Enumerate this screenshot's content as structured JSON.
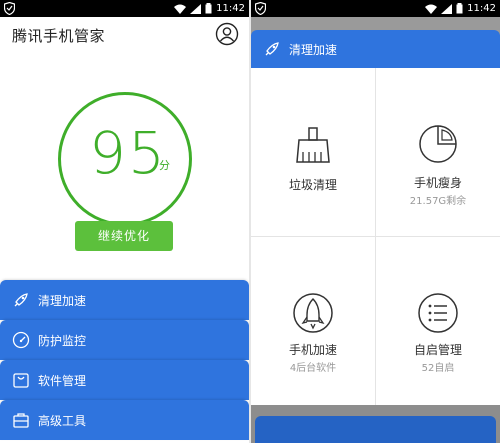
{
  "status_bar": {
    "time": "11:42"
  },
  "left": {
    "app_title": "腾讯手机管家",
    "score": {
      "value": "95",
      "unit": "分"
    },
    "optimize_button": "继续优化",
    "menu": [
      {
        "label": "清理加速",
        "icon": "rocket-icon"
      },
      {
        "label": "防护监控",
        "icon": "gauge-icon"
      },
      {
        "label": "软件管理",
        "icon": "bag-icon"
      },
      {
        "label": "高级工具",
        "icon": "toolbox-icon"
      }
    ]
  },
  "right": {
    "panel_title": "清理加速",
    "cells": [
      {
        "title": "垃圾清理",
        "subtitle": "",
        "icon": "broom-icon"
      },
      {
        "title": "手机瘦身",
        "subtitle": "21.57G剩余",
        "icon": "pie-chart-icon"
      },
      {
        "title": "手机加速",
        "subtitle": "4后台软件",
        "icon": "rocket-circle-icon"
      },
      {
        "title": "自启管理",
        "subtitle": "52自启",
        "icon": "list-icon"
      }
    ]
  },
  "colors": {
    "green": "#3fae2a",
    "button_green": "#5cc03c",
    "blue": "#2f74de"
  }
}
